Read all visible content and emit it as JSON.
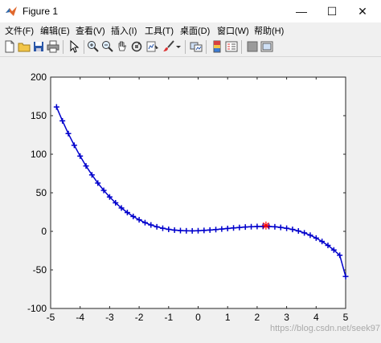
{
  "window": {
    "title": "Figure 1"
  },
  "window_controls": {
    "minimize": "—",
    "maximize": "☐",
    "close": "✕"
  },
  "menu": [
    {
      "label": "文件(F)"
    },
    {
      "label": "编辑(E)"
    },
    {
      "label": "查看(V)"
    },
    {
      "label": "插入(I)"
    },
    {
      "label": "工具(T)"
    },
    {
      "label": "桌面(D)"
    },
    {
      "label": "窗口(W)"
    },
    {
      "label": "帮助(H)"
    }
  ],
  "toolbar_icons": [
    "new-figure-icon",
    "open-file-icon",
    "save-icon",
    "print-icon",
    "pointer-icon",
    "zoom-in-icon",
    "zoom-out-icon",
    "pan-hand-icon",
    "rotate-3d-icon",
    "data-cursor-icon",
    "brush-icon",
    "link-plot-icon",
    "colorbar-icon",
    "legend-icon",
    "hide-plot-tools-icon",
    "show-plot-tools-icon"
  ],
  "colors": {
    "line": "#0000cc",
    "marker": "#0000cc",
    "highlight": "#ff0000",
    "axes_bg": "#ffffff"
  },
  "watermark": "https://blog.csdn.net/seek97",
  "chart_data": {
    "type": "line",
    "title": "",
    "xlabel": "",
    "ylabel": "",
    "xlim": [
      -5,
      5
    ],
    "ylim": [
      -100,
      200
    ],
    "xticks": [
      "-5",
      "-4",
      "-3",
      "-2",
      "-1",
      "0",
      "1",
      "2",
      "3",
      "4",
      "5"
    ],
    "yticks": [
      "-100",
      "-50",
      "0",
      "50",
      "100",
      "150",
      "200"
    ],
    "grid": false,
    "marker": "+",
    "series": [
      {
        "x": [
          -4.8,
          -4.6,
          -4.4,
          -4.2,
          -4.0,
          -3.8,
          -3.6,
          -3.4,
          -3.2,
          -3.0,
          -2.8,
          -2.6,
          -2.4,
          -2.2,
          -2.0,
          -1.8,
          -1.6,
          -1.4,
          -1.2,
          -1.0,
          -0.8,
          -0.6,
          -0.4,
          -0.2,
          0.0,
          0.2,
          0.4,
          0.6,
          0.8,
          1.0,
          1.2,
          1.4,
          1.6,
          1.8,
          2.0,
          2.2,
          2.4,
          2.6,
          2.8,
          3.0,
          3.2,
          3.4,
          3.6,
          3.8,
          4.0,
          4.2,
          4.4,
          4.6,
          4.8,
          5.0
        ],
        "y": [
          161.3,
          143.3,
          126.8,
          111.6,
          97.6,
          84.8,
          73.2,
          62.6,
          53.1,
          44.6,
          37.0,
          30.3,
          24.4,
          19.3,
          15.0,
          11.3,
          8.3,
          5.9,
          4.0,
          2.6,
          1.6,
          1.0,
          0.7,
          0.6,
          0.8,
          1.2,
          1.7,
          2.3,
          3.0,
          3.7,
          4.4,
          5.0,
          5.6,
          6.0,
          6.3,
          6.4,
          6.3,
          5.9,
          5.1,
          4.0,
          2.5,
          0.5,
          -2.0,
          -5.0,
          -8.7,
          -13.1,
          -18.2,
          -24.2,
          -31.0,
          -58.5
        ]
      }
    ],
    "highlight_point": {
      "x": 2.3,
      "y": 7.5,
      "marker": "*"
    }
  }
}
